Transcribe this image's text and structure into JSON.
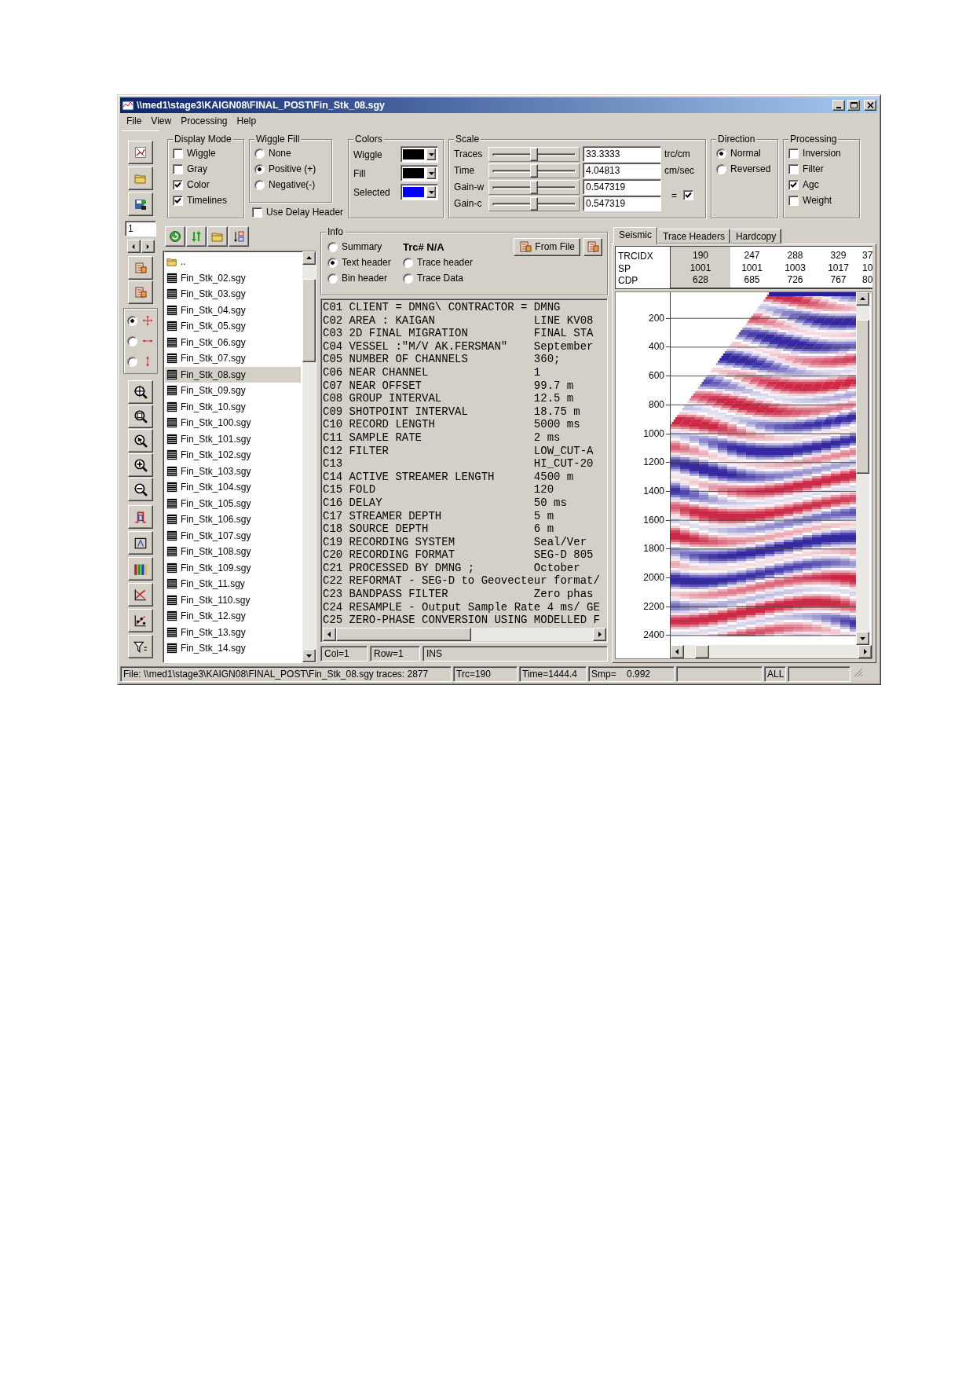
{
  "window": {
    "title": "\\\\med1\\stage3\\KAIGN08\\FINAL_POST\\Fin_Stk_08.sgy"
  },
  "menu": [
    "File",
    "View",
    "Processing",
    "Help"
  ],
  "display_mode": {
    "title": "Display Mode",
    "options": [
      {
        "label": "Wiggle",
        "checked": false
      },
      {
        "label": "Gray",
        "checked": false
      },
      {
        "label": "Color",
        "checked": true
      },
      {
        "label": "Timelines",
        "checked": true
      }
    ]
  },
  "wiggle_fill": {
    "title": "Wiggle Fill",
    "options": [
      {
        "label": "None",
        "selected": false
      },
      {
        "label": "Positive (+)",
        "selected": true
      },
      {
        "label": "Negative(-)",
        "selected": false
      }
    ]
  },
  "use_delay_header": {
    "label": "Use Delay  Header",
    "checked": false
  },
  "colors": {
    "title": "Colors",
    "items": [
      {
        "label": "Wiggle",
        "color": "#000000"
      },
      {
        "label": "Fill",
        "color": "#000000"
      },
      {
        "label": "Selected",
        "color": "#0000ff"
      }
    ]
  },
  "scale": {
    "title": "Scale",
    "rows": [
      {
        "label": "Traces",
        "level": 0.5,
        "value": "33.3333",
        "unit": "trc/cm"
      },
      {
        "label": "Time",
        "level": 0.5,
        "value": "4.04813",
        "unit": "cm/sec"
      },
      {
        "label": "Gain-w",
        "level": 0.5,
        "value": "0.547319"
      },
      {
        "label": "Gain-c",
        "level": 0.5,
        "value": "0.547319"
      }
    ],
    "link": {
      "label": "=",
      "checked": true
    }
  },
  "direction": {
    "title": "Direction",
    "options": [
      {
        "label": "Normal",
        "selected": true
      },
      {
        "label": "Reversed",
        "selected": false
      }
    ]
  },
  "processing": {
    "title": "Processing",
    "options": [
      {
        "label": "Inversion",
        "checked": false
      },
      {
        "label": "Filter",
        "checked": false
      },
      {
        "label": "Agc",
        "checked": true
      },
      {
        "label": "Weight",
        "checked": false
      }
    ]
  },
  "trace_field": {
    "value": "1"
  },
  "pick_modes": [
    {
      "selected": true
    },
    {
      "selected": false
    },
    {
      "selected": false
    }
  ],
  "files": {
    "items": [
      {
        "name": "..",
        "kind": "folder",
        "selected": false
      },
      {
        "name": "Fin_Stk_02.sgy",
        "kind": "file",
        "selected": false
      },
      {
        "name": "Fin_Stk_03.sgy",
        "kind": "file",
        "selected": false
      },
      {
        "name": "Fin_Stk_04.sgy",
        "kind": "file",
        "selected": false
      },
      {
        "name": "Fin_Stk_05.sgy",
        "kind": "file",
        "selected": false
      },
      {
        "name": "Fin_Stk_06.sgy",
        "kind": "file",
        "selected": false
      },
      {
        "name": "Fin_Stk_07.sgy",
        "kind": "file",
        "selected": false
      },
      {
        "name": "Fin_Stk_08.sgy",
        "kind": "file",
        "selected": true
      },
      {
        "name": "Fin_Stk_09.sgy",
        "kind": "file",
        "selected": false
      },
      {
        "name": "Fin_Stk_10.sgy",
        "kind": "file",
        "selected": false
      },
      {
        "name": "Fin_Stk_100.sgy",
        "kind": "file",
        "selected": false
      },
      {
        "name": "Fin_Stk_101.sgy",
        "kind": "file",
        "selected": false
      },
      {
        "name": "Fin_Stk_102.sgy",
        "kind": "file",
        "selected": false
      },
      {
        "name": "Fin_Stk_103.sgy",
        "kind": "file",
        "selected": false
      },
      {
        "name": "Fin_Stk_104.sgy",
        "kind": "file",
        "selected": false
      },
      {
        "name": "Fin_Stk_105.sgy",
        "kind": "file",
        "selected": false
      },
      {
        "name": "Fin_Stk_106.sgy",
        "kind": "file",
        "selected": false
      },
      {
        "name": "Fin_Stk_107.sgy",
        "kind": "file",
        "selected": false
      },
      {
        "name": "Fin_Stk_108.sgy",
        "kind": "file",
        "selected": false
      },
      {
        "name": "Fin_Stk_109.sgy",
        "kind": "file",
        "selected": false
      },
      {
        "name": "Fin_Stk_11.sgy",
        "kind": "file",
        "selected": false
      },
      {
        "name": "Fin_Stk_110.sgy",
        "kind": "file",
        "selected": false
      },
      {
        "name": "Fin_Stk_12.sgy",
        "kind": "file",
        "selected": false
      },
      {
        "name": "Fin_Stk_13.sgy",
        "kind": "file",
        "selected": false
      },
      {
        "name": "Fin_Stk_14.sgy",
        "kind": "file",
        "selected": false
      }
    ]
  },
  "info": {
    "title": "Info",
    "trace": "Trc# N/A",
    "load_button": "From File",
    "options": [
      {
        "label": "Summary",
        "selected": false
      },
      {
        "label": "Text header",
        "selected": true
      },
      {
        "label": "Trace header",
        "selected": false
      },
      {
        "label": "Bin header",
        "selected": false
      },
      {
        "label": "Trace Data",
        "selected": false
      }
    ],
    "lines": [
      {
        "text": "C01 CLIENT = DMNG\\ CONTRACTOR = DMNG"
      },
      {
        "text": "C02 AREA : KAIGAN",
        "value": "LINE KV08"
      },
      {
        "text": "C03 2D FINAL MIGRATION",
        "value": "FINAL STA"
      },
      {
        "text": "C04 VESSEL :\"M/V AK.FERSMAN\"",
        "value": "September"
      },
      {
        "text": "C05 NUMBER OF CHANNELS",
        "value": "360;"
      },
      {
        "text": "C06 NEAR CHANNEL",
        "value": "1"
      },
      {
        "text": "C07 NEAR OFFSET",
        "value": "99.7 m"
      },
      {
        "text": "C08 GROUP INTERVAL",
        "value": "12.5 m"
      },
      {
        "text": "C09 SHOTPOINT INTERVAL",
        "value": "18.75 m"
      },
      {
        "text": "C10 RECORD LENGTH",
        "value": "5000 ms"
      },
      {
        "text": "C11 SAMPLE RATE",
        "value": "2 ms"
      },
      {
        "text": "C12 FILTER",
        "value": "LOW_CUT-A"
      },
      {
        "text": "C13",
        "value": "HI_CUT-20"
      },
      {
        "text": "C14 ACTIVE STREAMER LENGTH",
        "value": "4500 m"
      },
      {
        "text": "C15 FOLD",
        "value": "120"
      },
      {
        "text": "C16 DELAY",
        "value": "50 ms"
      },
      {
        "text": "C17 STREAMER DEPTH",
        "value": "5 m"
      },
      {
        "text": "C18 SOURCE DEPTH",
        "value": "6 m"
      },
      {
        "text": "C19 RECORDING SYSTEM",
        "value": "Seal/Ver"
      },
      {
        "text": "C20 RECORDING FORMAT",
        "value": "SEG-D 805"
      },
      {
        "text": "C21 PROCESSED BY DMNG ;",
        "value": "October"
      },
      {
        "text": "C22 REFORMAT - SEG-D to Geovecteur format/"
      },
      {
        "text": "C23 BANDPASS FILTER",
        "value": "Zero phas"
      },
      {
        "text": "C24 RESAMPLE - Output Sample Rate 4 ms/ GE"
      },
      {
        "text": "C25 ZERO-PHASE CONVERSION USING MODELLED F"
      }
    ],
    "status": [
      "Col=1",
      "Row=1",
      "INS"
    ]
  },
  "seismic": {
    "tabs": [
      {
        "label": "Seismic",
        "selected": true
      },
      {
        "label": "Trace Headers",
        "selected": false
      },
      {
        "label": "Hardcopy",
        "selected": false
      }
    ],
    "header_labels": [
      "TRCIDX",
      "SP",
      "CDP"
    ],
    "header_columns": [
      {
        "values": [
          "190",
          "1001",
          "628"
        ],
        "selected": true
      },
      {
        "values": [
          "247",
          "1001",
          "685"
        ],
        "selected": false
      },
      {
        "values": [
          "288",
          "1003",
          "726"
        ],
        "selected": false
      },
      {
        "values": [
          "329",
          "1017",
          "767"
        ],
        "selected": false
      },
      {
        "values": [
          "37",
          "10",
          "80"
        ],
        "selected": false
      }
    ],
    "time_ticks": [
      "200",
      "400",
      "600",
      "800",
      "1000",
      "1200",
      "1400",
      "1600",
      "1800",
      "2000",
      "2200",
      "2400"
    ]
  },
  "status_bar": {
    "file": "File: \\\\med1\\stage3\\KAIGN08\\FINAL_POST\\Fin_Stk_08.sgy traces: 2877",
    "trace": "Trc=190",
    "time": "Time=1444.4",
    "sample": "Smp=",
    "sample_value": "0.992",
    "range": "ALL"
  }
}
